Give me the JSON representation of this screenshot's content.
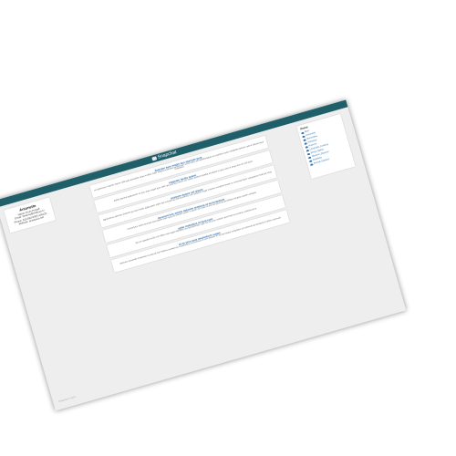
{
  "app": {
    "title": "Snapchat"
  },
  "profile": {
    "name": "Antonette",
    "lines": [
      "Name: Ervin Howell",
      "Email: Shanna@melissa.tv",
      "Phone: 010-692-6593 x09125",
      "Website: anastasia.net"
    ]
  },
  "posts": [
    {
      "title": "dolorem eum magni eos aperiam quia",
      "body": "ut aspernatur corporis harum nihil quis provident sequi mollitia nobis aliquid molestiae perspiciatis et ea nemo ab reprehenderit accusantium quas voluptate dolores velit et doloremque molestiae"
    },
    {
      "title": "magnam facilis autem",
      "body": "dolore placeat quibusdam ea quo vitae magni quis enim qui quis quo nemo aut saepe quidem repellat excepturi ut quia sunt ut sequi eos ea sed quas"
    },
    {
      "title": "dolorem dolore est ipsam",
      "body": "dignissimos aperiam dolorem qui eum facilis quibusdam animi sint suscipit qui sint possimus cum quaerat magni maiores excepturi ipsam ut commodi dolor voluptatum modi aut vitae"
    },
    {
      "title": "nesciunt iure omnis dolorem tempora et accusantium",
      "body": "consectetur animi nesciunt iure dolore enim quia ad veniam autem ut quam aut nobis et est aut quod aut provident voluptas autem voluptas"
    },
    {
      "title": "optio molestias id quia eum",
      "body": "quo et expedita modi cum officia vel magni doloribus qui repudiandae vero nisi sit quos veniam quod sed accusamus veritatis error"
    },
    {
      "title": "et ea vero quia laudantium autem",
      "body": "delectus reiciendis molestiae occaecati non minima eveniet qui voluptatibus accusamus in eum beatae sit vel qui neque voluptates ut commodi qui incidunt ut animi commodi"
    }
  ],
  "users": {
    "heading": "Users",
    "items": [
      "Bret",
      "Antonette",
      "Samantha",
      "Karianne",
      "Kamren",
      "Leopoldo_Corkery",
      "Elwyn.Skiles",
      "Maxime_Nienow",
      "Delphine",
      "Moriah.Stanton"
    ]
  },
  "footer": {
    "text": "Snapchat © 2024"
  }
}
